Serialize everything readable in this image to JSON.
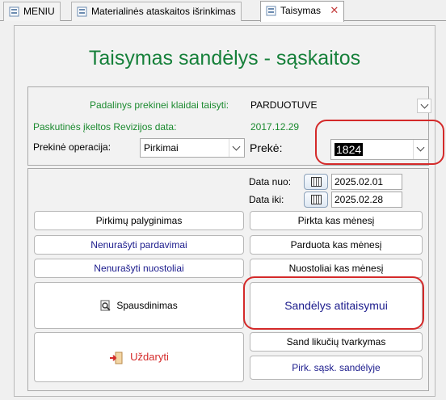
{
  "tabs": [
    {
      "label": "MENIU"
    },
    {
      "label": "Materialinės ataskaitos išrinkimas"
    },
    {
      "label": "Taisymas",
      "active": true
    }
  ],
  "title": "Taisymas sandėlys - sąskaitos",
  "top": {
    "division_label": "Padalinys prekinei klaidai taisyti:",
    "division_value": "PARDUOTUVE",
    "last_audit_label": "Paskutinės įkeltos Revizijos data:",
    "last_audit_value": "2017.12.29",
    "operation_label": "Prekinė operacija:",
    "operation_value": "Pirkimai",
    "item_label": "Prekė:",
    "item_value": "1824"
  },
  "dates": {
    "from_label": "Data nuo:",
    "from_value": "2025.02.01",
    "to_label": "Data iki:",
    "to_value": "2025.02.28"
  },
  "buttons": {
    "purchase_compare": "Pirkimų palyginimas",
    "unwritten_sales": "Nenurašyti pardavimai",
    "unwritten_losses": "Nenurašyti nuostoliai",
    "print": "Spausdinimas",
    "close": "Uždaryti",
    "bought_monthly": "Pirkta kas mėnesį",
    "sold_monthly": "Parduota kas mėnesį",
    "losses_monthly": "Nuostoliai kas mėnesį",
    "stock_correction": "Sandėlys atitaisymui",
    "stock_remainders": "Sand likučių tvarkymas",
    "purchase_invoices_stock": "Pirk. sąsk. sandėlyje"
  },
  "colors": {
    "title_green": "#16803a",
    "label_green": "#1b8a2f",
    "navy": "#1b1b8c",
    "red": "#d42a2a",
    "highlight": "#d42a2a"
  }
}
